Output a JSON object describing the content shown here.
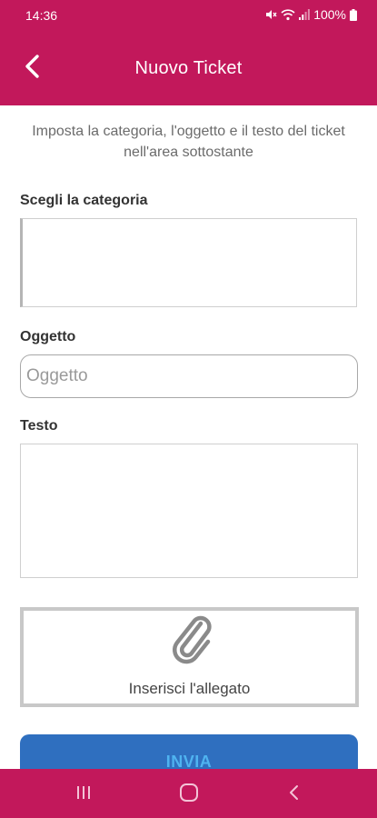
{
  "status_bar": {
    "time": "14:36",
    "battery": "100%"
  },
  "app_bar": {
    "title": "Nuovo Ticket",
    "back_icon": "chevron-left-icon"
  },
  "intro": {
    "text": "Imposta la categoria, l'oggetto e il testo del ticket nell'area sottostante"
  },
  "form": {
    "category_label": "Scegli la categoria",
    "subject_label": "Oggetto",
    "subject_placeholder": "Oggetto",
    "subject_value": "",
    "text_label": "Testo",
    "text_value": "",
    "attachment_label": "Inserisci l'allegato",
    "attachment_icon": "paperclip-icon",
    "submit_label": "INVIA"
  },
  "nav_bar": {
    "recents_icon": "recents-icon",
    "home_icon": "home-icon",
    "back_icon": "back-icon"
  },
  "colors": {
    "primary": "#c2185b",
    "button": "#2f6fbf",
    "button_text": "#4fb3f0"
  }
}
